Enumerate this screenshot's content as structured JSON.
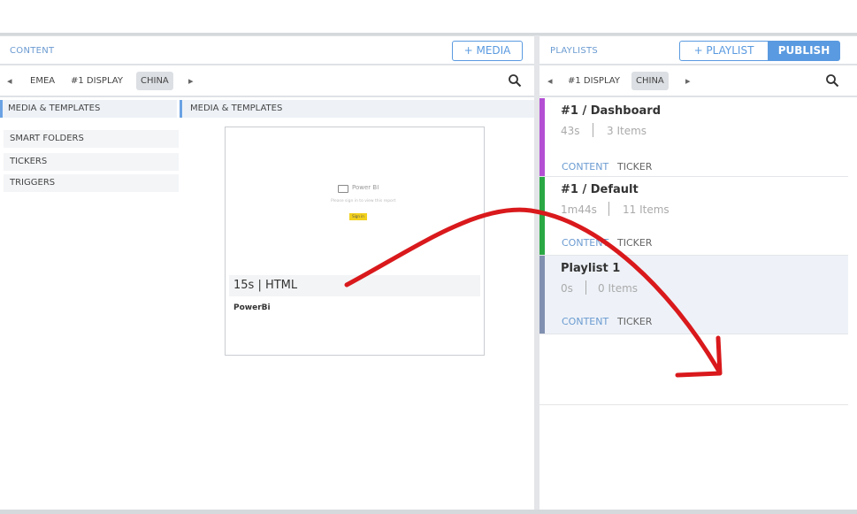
{
  "content_panel": {
    "title": "CONTENT",
    "add_media_label": "+ MEDIA",
    "tabs": [
      {
        "label": "EMEA",
        "active": false
      },
      {
        "label": "#1 DISPLAY",
        "active": false
      },
      {
        "label": "CHINA",
        "active": true
      }
    ],
    "sidebar": [
      {
        "label": "MEDIA & TEMPLATES",
        "selected": true
      },
      {
        "label": "SMART FOLDERS",
        "selected": false
      },
      {
        "label": "TICKERS",
        "selected": false
      },
      {
        "label": "TRIGGERS",
        "selected": false
      }
    ],
    "breadcrumb": "MEDIA & TEMPLATES",
    "card": {
      "thumb_title": "Power BI",
      "thumb_subtitle": "Please sign in to view this report",
      "thumb_button": "Sign in",
      "meta": "15s | HTML",
      "name": "PowerBi"
    }
  },
  "playlists_panel": {
    "title": "PLAYLISTS",
    "add_playlist_label": "+ PLAYLIST",
    "publish_label": "PUBLISH",
    "tabs": [
      {
        "label": "#1 DISPLAY",
        "active": false
      },
      {
        "label": "CHINA",
        "active": true
      }
    ],
    "playlists": [
      {
        "title": "#1 / Dashboard",
        "duration": "43s",
        "items": "3 Items",
        "content_label": "CONTENT",
        "ticker_label": "TICKER",
        "bar_color": "#b44fd4"
      },
      {
        "title": "#1 / Default",
        "duration": "1m44s",
        "items": "11 Items",
        "content_label": "CONTENT",
        "ticker_label": "TICKER",
        "bar_color": "#2aa844"
      },
      {
        "title": "Playlist 1",
        "duration": "0s",
        "items": "0 Items",
        "content_label": "CONTENT",
        "ticker_label": "TICKER",
        "bar_color": "#8090b0",
        "highlighted": true
      }
    ]
  },
  "colors": {
    "accent": "#5a9ae0",
    "annotation_arrow": "#d9191c"
  },
  "icons": {
    "search": "search-icon",
    "arrow_left": "chevron-left-icon",
    "arrow_right": "chevron-right-icon"
  }
}
